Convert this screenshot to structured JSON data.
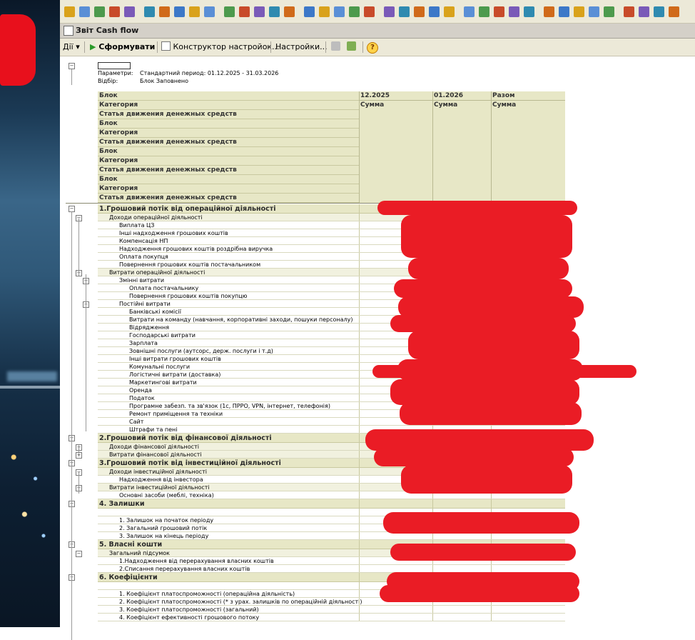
{
  "window": {
    "title": "Звіт  Cash flow"
  },
  "actions": {
    "menu": "Дії",
    "generate": "Сформувати",
    "constructor": "Конструктор настройок...",
    "settings": "Настройки...",
    "help": "?"
  },
  "params": {
    "params_label": "Параметри:",
    "params_value": "Стандартний период: 01.12.2025 - 31.03.2026",
    "filter_label": "Відбір:",
    "filter_value": "Блок Заповнено"
  },
  "header": {
    "row_labels": [
      "Блок",
      "Категория",
      "Статья движения денежных средств",
      "Блок",
      "Категория",
      "Статья движения денежных средств",
      "Блок",
      "Категория",
      "Статья движения денежных средств",
      "Блок",
      "Категория",
      "Статья движения денежных средств"
    ],
    "columns": [
      "12.2025",
      "01.2026",
      "Разом"
    ],
    "subcolumns": [
      "Сумма",
      "Сумма",
      "Сумма"
    ]
  },
  "rows": [
    {
      "l": 1,
      "t": "1.Грошовий потік від операційної діяльності",
      "tree": "minus"
    },
    {
      "l": 2,
      "t": "Доходи операційної діяльності",
      "tree": "minus"
    },
    {
      "l": 3,
      "t": "Виплата ЦЗ"
    },
    {
      "l": 3,
      "t": "Інші надходження грошових коштів"
    },
    {
      "l": 3,
      "t": "Компенсація  НП"
    },
    {
      "l": 3,
      "t": "Надходження грошових коштів роздрібна виручка"
    },
    {
      "l": 3,
      "t": "Оплата покупця"
    },
    {
      "l": 3,
      "t": "Повернення грошових коштів постачальником"
    },
    {
      "l": 2,
      "t": "Витрати операційної діяльності",
      "tree": "minus"
    },
    {
      "l": 3,
      "t": "Змінні витрати",
      "tree": "minus"
    },
    {
      "l": 4,
      "t": "Оплата постачальнику"
    },
    {
      "l": 4,
      "t": "Повернення грошових коштів покупцю"
    },
    {
      "l": 3,
      "t": "Постійні витрати",
      "tree": "minus"
    },
    {
      "l": 4,
      "t": "Банківські комісії"
    },
    {
      "l": 4,
      "t": "Витрати на команду (навчання, корпоративні заходи, пошуки персоналу)"
    },
    {
      "l": 4,
      "t": "Відрядження"
    },
    {
      "l": 4,
      "t": "Господарські витрати"
    },
    {
      "l": 4,
      "t": "Зарплата"
    },
    {
      "l": 4,
      "t": "Зовнішні послуги (аутсорс, держ. послуги і т.д)"
    },
    {
      "l": 4,
      "t": "Інші витрати грошових коштів"
    },
    {
      "l": 4,
      "t": "Комунальні послуги"
    },
    {
      "l": 4,
      "t": "Логістичні витрати (доставка)"
    },
    {
      "l": 4,
      "t": "Маркетингові витрати"
    },
    {
      "l": 4,
      "t": "Оренда"
    },
    {
      "l": 4,
      "t": "Податок"
    },
    {
      "l": 4,
      "t": "Програмне забезп. та зв'язок (1с, ПРРО, VPN, інтернет, телефонія)"
    },
    {
      "l": 4,
      "t": "Ремонт приміщення та техніки"
    },
    {
      "l": 4,
      "t": "Сайт"
    },
    {
      "l": 4,
      "t": "Штрафи та пені"
    },
    {
      "l": 1,
      "t": "2.Грошовий потік від фінансової діяльності",
      "tree": "minus"
    },
    {
      "l": 2,
      "t": "Доходи фінансової діяльності",
      "tree": "plus"
    },
    {
      "l": 2,
      "t": "Витрати фінансової діяльності",
      "tree": "plus"
    },
    {
      "l": 1,
      "t": "3.Грошовий потік від інвестиційної діяльності",
      "tree": "minus"
    },
    {
      "l": 2,
      "t": "Доходи інвестиційної діяльності",
      "tree": "minus"
    },
    {
      "l": 3,
      "t": "Надходження від інвестора"
    },
    {
      "l": 2,
      "t": "Витрати інвестиційної діяльності",
      "tree": "minus"
    },
    {
      "l": 3,
      "t": "Основні засоби (меблі, техніка)"
    },
    {
      "l": 1,
      "t": "4. Залишки",
      "tree": "minus"
    },
    {
      "l": 3,
      "t": ""
    },
    {
      "l": 3,
      "t": "1. Залишок на початок періоду"
    },
    {
      "l": 3,
      "t": "2. Загальний грошовий потік"
    },
    {
      "l": 3,
      "t": "3. Залишок на кінець періоду"
    },
    {
      "l": 1,
      "t": "5. Власні кошти",
      "tree": "minus"
    },
    {
      "l": 2,
      "t": "Загальний підсумок",
      "tree": "minus"
    },
    {
      "l": 3,
      "t": "1.Надходження від перерахування власних коштів"
    },
    {
      "l": 3,
      "t": "2.Списання перерахування власних коштів"
    },
    {
      "l": 1,
      "t": "6. Коефіцієнти",
      "tree": "minus"
    },
    {
      "l": 3,
      "t": ""
    },
    {
      "l": 3,
      "t": "1. Коефіцієнт платоспроможності (операційна діяльність)"
    },
    {
      "l": 3,
      "t": "2. Коефіцієнт платоспроможності (* з урах. залишків по операційній діяльності)"
    },
    {
      "l": 3,
      "t": "3. Коефіцієнт платоспроможності (загальний)"
    },
    {
      "l": 3,
      "t": "4. Коефіцієнт ефективності грошового потоку"
    }
  ],
  "colors": {
    "header_bg": "#e7e7c6",
    "redaction": "#ea1c25",
    "toolbar_bg": "#ece9d8"
  }
}
